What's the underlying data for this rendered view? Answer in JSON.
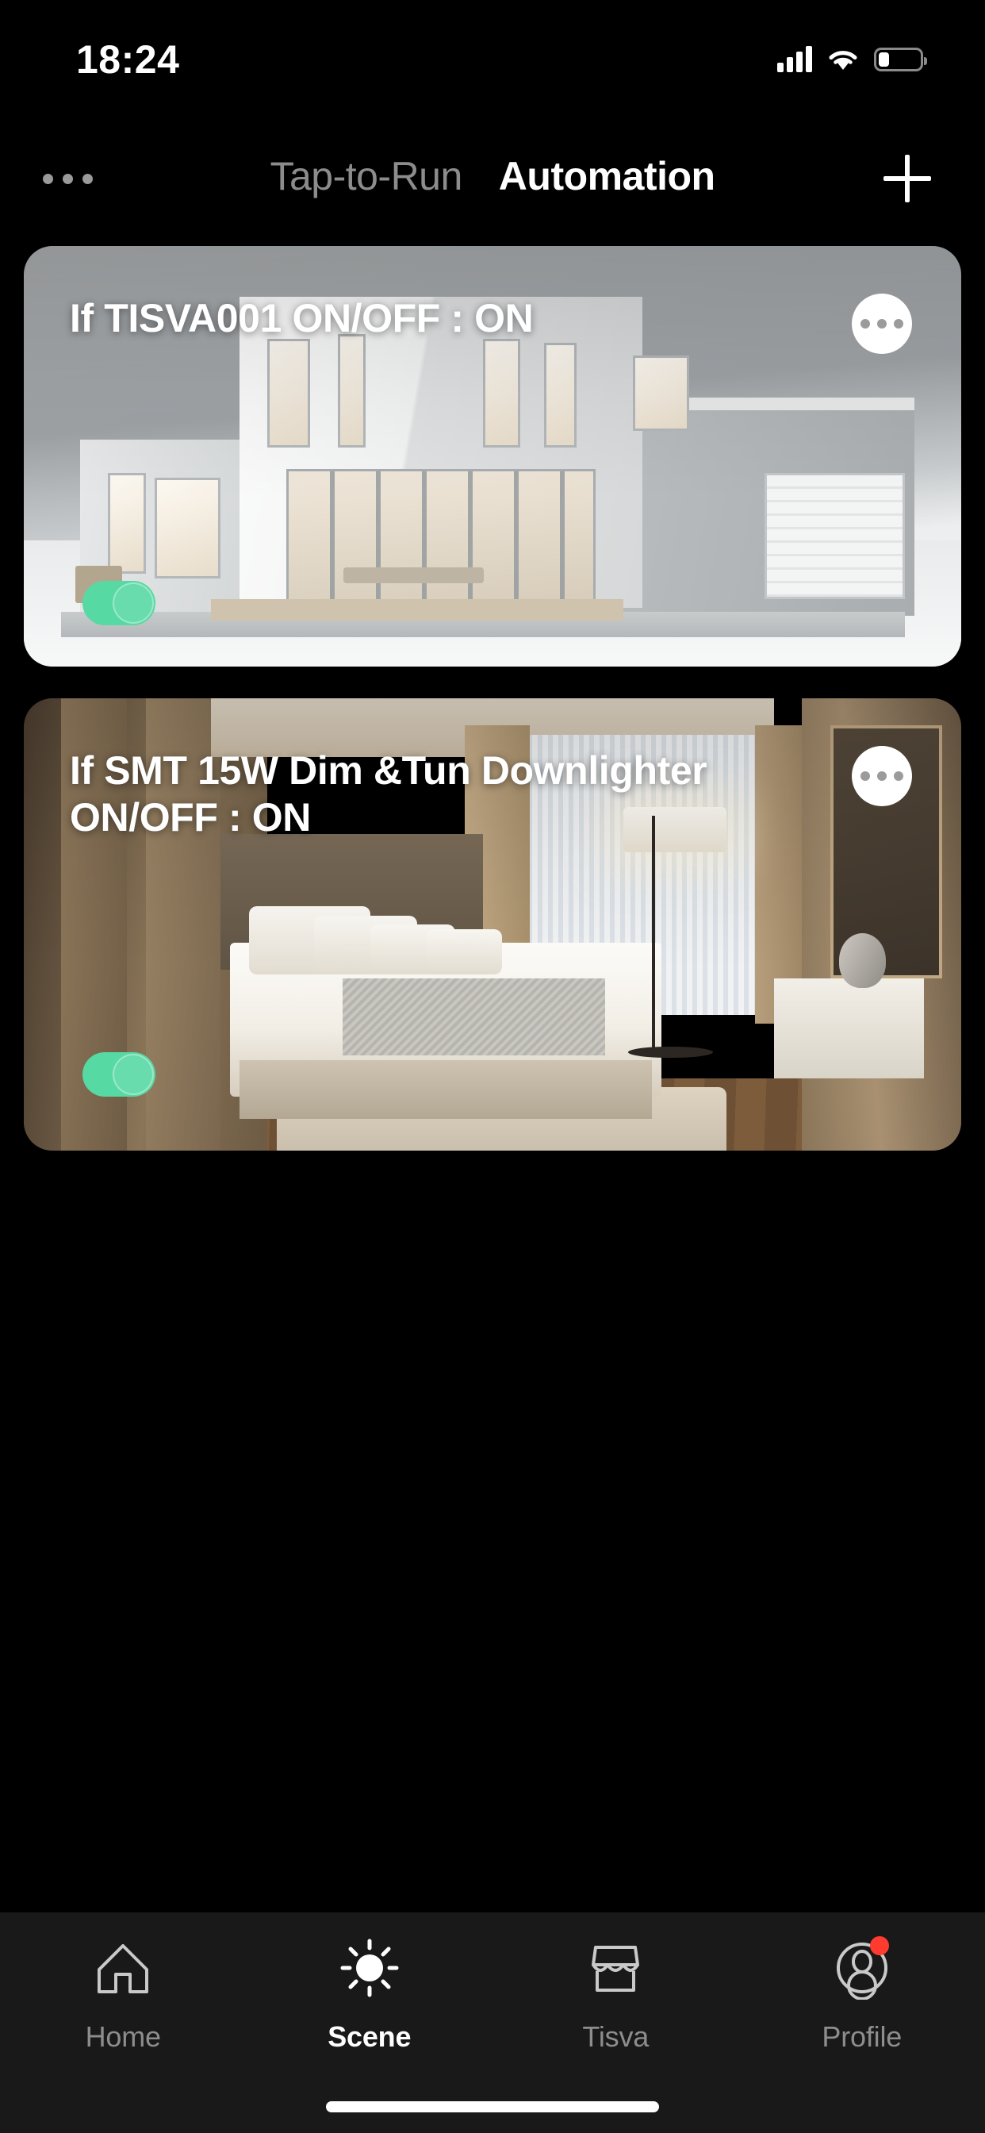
{
  "status_bar": {
    "time": "18:24",
    "signal_icon": "cellular-signal-icon",
    "wifi_icon": "wifi-icon",
    "battery_icon": "battery-low-icon",
    "battery_level_percent": 25
  },
  "header": {
    "menu_icon": "more-options-icon",
    "add_icon": "plus-icon",
    "tabs": [
      {
        "label": "Tap-to-Run",
        "active": false
      },
      {
        "label": "Automation",
        "active": true
      }
    ]
  },
  "automations": [
    {
      "title": "If TISVA001 ON/OFF : ON",
      "more_icon": "more-horizontal-icon",
      "toggle_state": "on",
      "scene": "modern-white-house"
    },
    {
      "title": "If SMT 15W Dim &Tun Downlighter ON/OFF : ON",
      "more_icon": "more-horizontal-icon",
      "toggle_state": "on",
      "scene": "luxury-bedroom"
    }
  ],
  "bottom_nav": {
    "items": [
      {
        "label": "Home",
        "icon": "house-icon",
        "active": false,
        "badge": false
      },
      {
        "label": "Scene",
        "icon": "sun-icon",
        "active": true,
        "badge": false
      },
      {
        "label": "Tisva",
        "icon": "store-icon",
        "active": false,
        "badge": false
      },
      {
        "label": "Profile",
        "icon": "user-circle-icon",
        "active": false,
        "badge": true
      }
    ]
  },
  "colors": {
    "background": "#000000",
    "nav_background": "#191919",
    "accent_green": "#57d9a3",
    "active_text": "#ffffff",
    "inactive_text": "#8d8d8d",
    "badge_red": "#ff3b30"
  }
}
